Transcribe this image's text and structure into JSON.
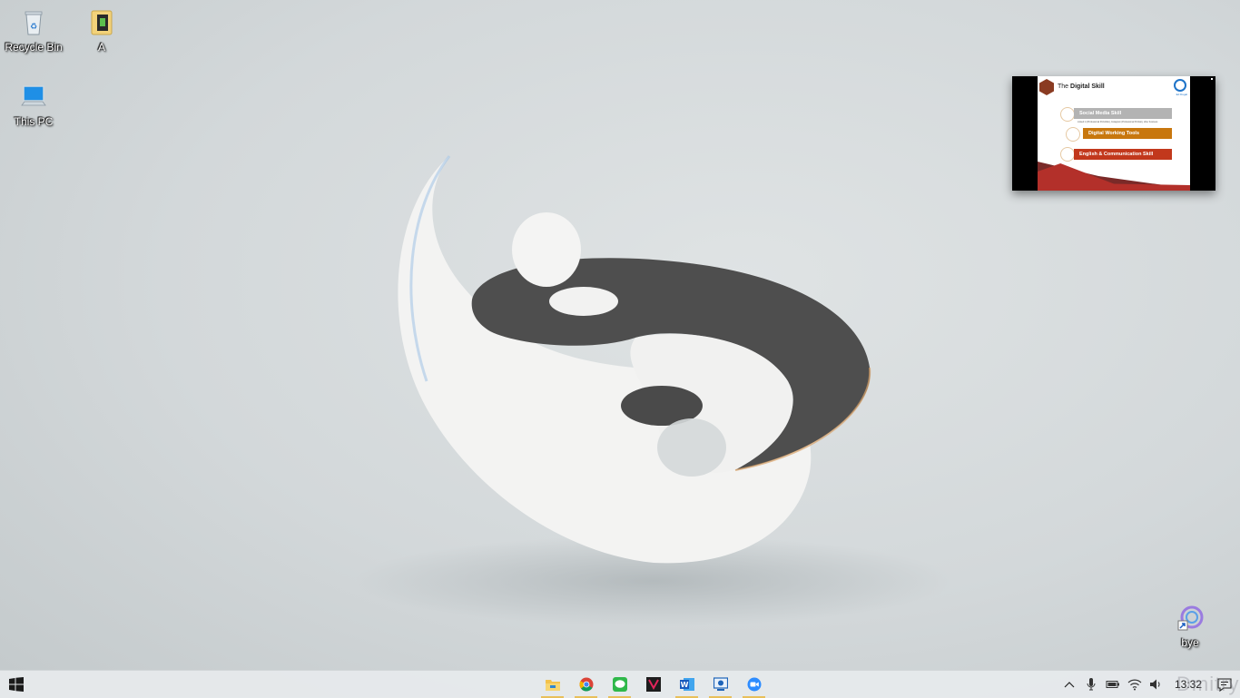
{
  "desktop_icons": [
    {
      "label": "Recycle Bin",
      "icon": "recycle-bin-icon"
    },
    {
      "label": "A",
      "icon": "folder-icon"
    },
    {
      "label": "This PC",
      "icon": "computer-icon"
    },
    {
      "label": "bye",
      "icon": "shortcut-icon"
    }
  ],
  "pip": {
    "title_prefix": "The",
    "title_bold": "Digital Skill",
    "logo_text": "Ed Dugal",
    "items": [
      {
        "label": "Social Media Skill",
        "color": "#b3b3b3"
      },
      {
        "label": "Digital Working Tools",
        "color": "#c8770e"
      },
      {
        "label": "English & Communication  Skill",
        "color": "#c2381c"
      }
    ],
    "subtitle": "Linked in (Professional Portofolio), Instagram (Professional Portrait), other business"
  },
  "taskbar": {
    "apps": [
      {
        "icon": "file-explorer-icon",
        "active": true
      },
      {
        "icon": "chrome-icon",
        "active": true
      },
      {
        "icon": "line-chat-icon",
        "active": true
      },
      {
        "icon": "media-app-icon",
        "active": false
      },
      {
        "icon": "word-icon",
        "active": true
      },
      {
        "icon": "remote-desktop-icon",
        "active": true
      },
      {
        "icon": "zoom-icon",
        "active": true
      }
    ],
    "clock": "13:32"
  },
  "watermark": "DmitryJS"
}
